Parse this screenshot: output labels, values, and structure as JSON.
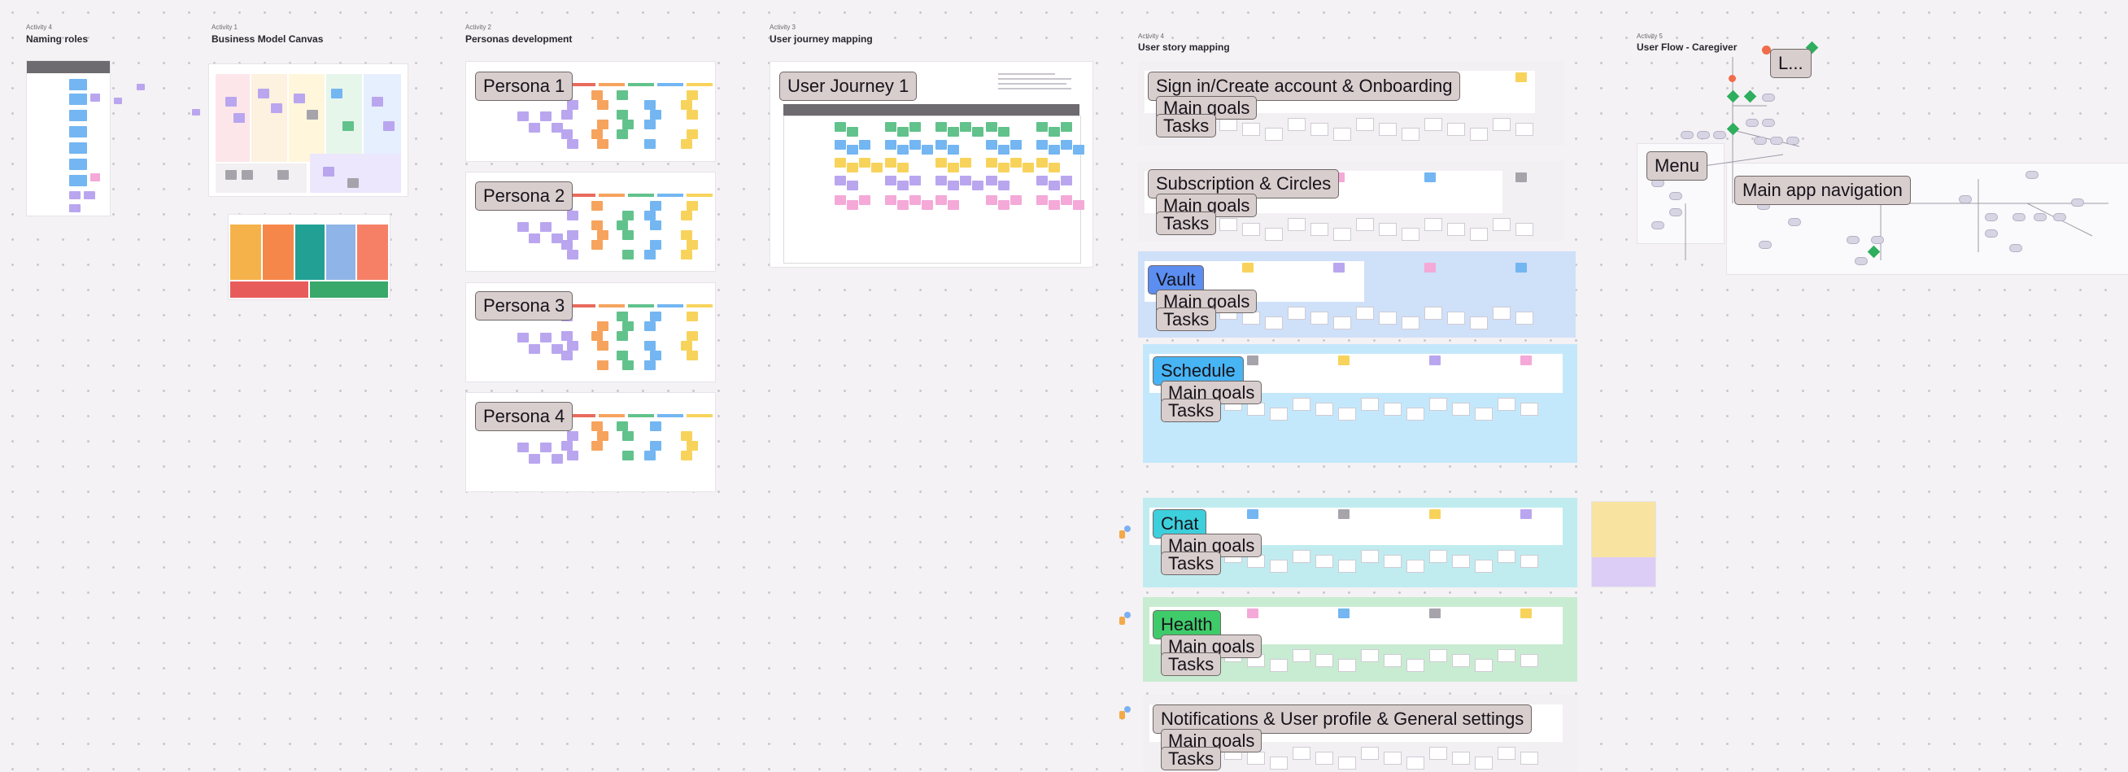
{
  "activities": [
    {
      "num": "Activity 4",
      "title": "Naming roles"
    },
    {
      "num": "Activity 1",
      "title": "Business Model Canvas"
    },
    {
      "num": "Activity 2",
      "title": "Personas development"
    },
    {
      "num": "Activity 3",
      "title": "User journey mapping"
    },
    {
      "num": "Activity 4",
      "title": "User story mapping"
    },
    {
      "num": "Activity 5",
      "title": "User Flow - Caregiver"
    }
  ],
  "personas": [
    "Persona 1",
    "Persona 2",
    "Persona 3",
    "Persona 4"
  ],
  "journey": {
    "label": "User Journey 1"
  },
  "story_sections": [
    {
      "label": "Sign in/Create account & Onboarding",
      "goals": "Main goals",
      "tasks": "Tasks",
      "color": "#f2f0f3",
      "tag_color": "#d9cece"
    },
    {
      "label": "Subscription & Circles",
      "goals": "Main goals",
      "tasks": "Tasks",
      "color": "#f2f0f3",
      "tag_color": "#d9cece"
    },
    {
      "label": "Vault",
      "goals": "Main goals",
      "tasks": "Tasks",
      "color": "#cfe0f9",
      "tag_color": "#5b8ef0"
    },
    {
      "label": "Schedule",
      "goals": "Main goals",
      "tasks": "Tasks",
      "color": "#c4e8fb",
      "tag_color": "#47b4f4"
    },
    {
      "label": "Chat",
      "goals": "Main goals",
      "tasks": "Tasks",
      "color": "#c0ecf0",
      "tag_color": "#3dcfdc"
    },
    {
      "label": "Health",
      "goals": "Main goals",
      "tasks": "Tasks",
      "color": "#c8ecd1",
      "tag_color": "#3fcb6a"
    },
    {
      "label": "Notifications & User profile & General settings",
      "goals": "Main goals",
      "tasks": "Tasks",
      "color": "#f2f0f3",
      "tag_color": "#d9cece"
    }
  ],
  "flow": {
    "menu": "Menu",
    "nav": "Main app navigation",
    "top": "L..."
  },
  "colors": {
    "purple": "#b9a6ef",
    "blue": "#73b6f2",
    "green": "#62c28c",
    "yellow": "#f8d35c",
    "orange": "#f6a35e",
    "pink": "#f4a9d8",
    "gray": "#a7a3ab",
    "red": "#e86b5d"
  }
}
